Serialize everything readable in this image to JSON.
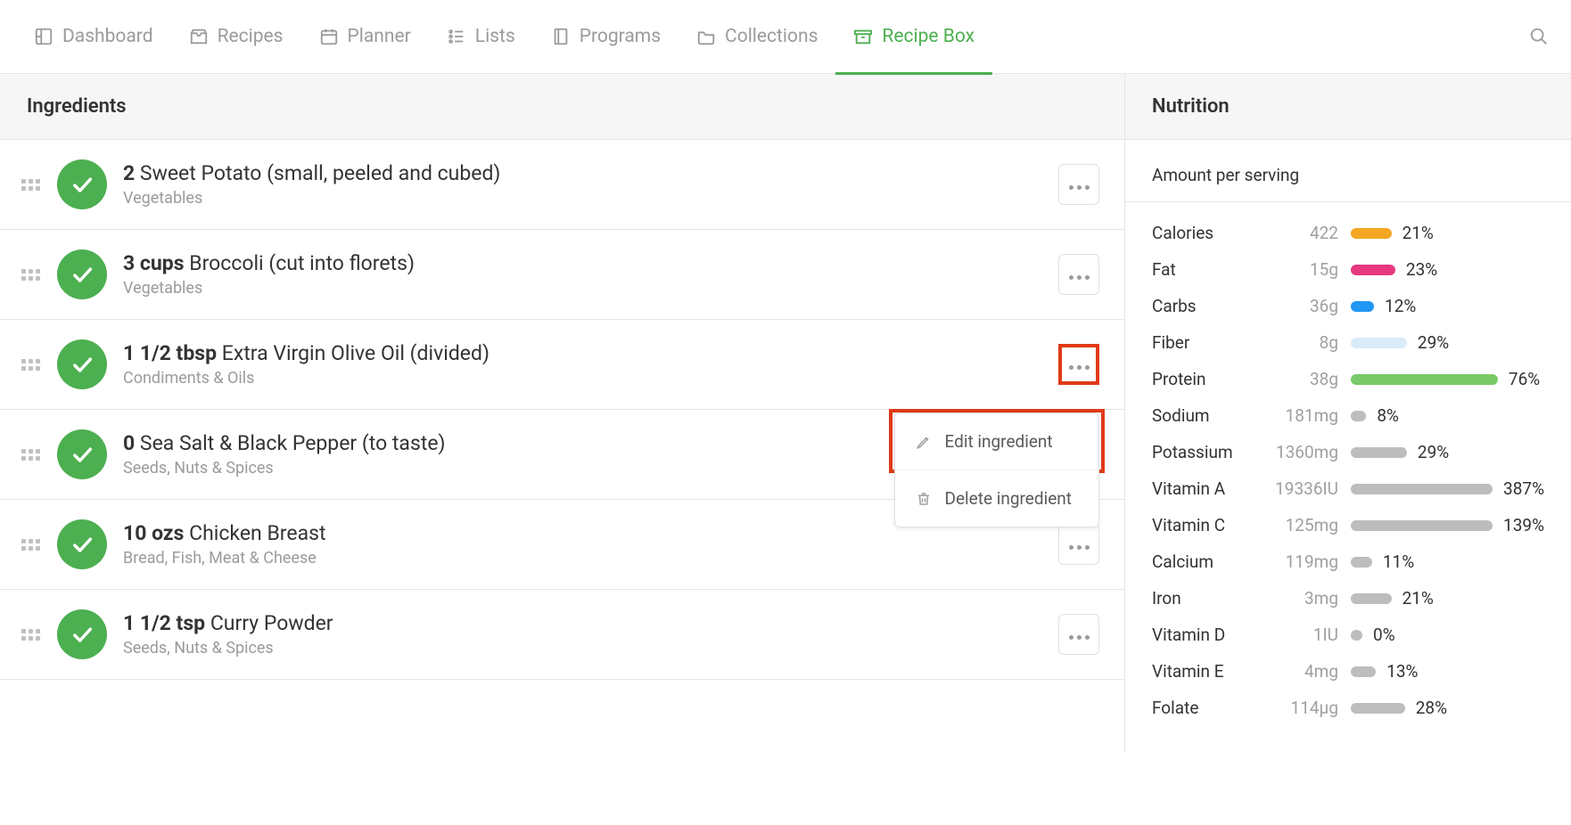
{
  "nav": {
    "items": [
      {
        "label": "Dashboard",
        "icon": "dashboard",
        "active": false
      },
      {
        "label": "Recipes",
        "icon": "inbox",
        "active": false
      },
      {
        "label": "Planner",
        "icon": "calendar",
        "active": false
      },
      {
        "label": "Lists",
        "icon": "lists",
        "active": false
      },
      {
        "label": "Programs",
        "icon": "book",
        "active": false
      },
      {
        "label": "Collections",
        "icon": "folder",
        "active": false
      },
      {
        "label": "Recipe Box",
        "icon": "box",
        "active": true
      }
    ]
  },
  "ingredients_header": "Ingredients",
  "ingredients": [
    {
      "qty": "2",
      "name": "Sweet Potato (small, peeled and cubed)",
      "category": "Vegetables"
    },
    {
      "qty": "3 cups",
      "name": "Broccoli (cut into florets)",
      "category": "Vegetables"
    },
    {
      "qty": "1 1/2 tbsp",
      "name": "Extra Virgin Olive Oil (divided)",
      "category": "Condiments & Oils"
    },
    {
      "qty": "0",
      "name": "Sea Salt & Black Pepper (to taste)",
      "category": "Seeds, Nuts & Spices"
    },
    {
      "qty": "10 ozs",
      "name": "Chicken Breast",
      "category": "Bread, Fish, Meat & Cheese"
    },
    {
      "qty": "1 1/2 tsp",
      "name": "Curry Powder",
      "category": "Seeds, Nuts & Spices"
    }
  ],
  "dropdown": {
    "edit": "Edit ingredient",
    "delete": "Delete ingredient"
  },
  "nutrition_header": "Nutrition",
  "nutrition_sub": "Amount per serving",
  "nutrition": [
    {
      "label": "Calories",
      "value": "422",
      "pct": "21%",
      "bar_pct": 21,
      "color": "#f5a623"
    },
    {
      "label": "Fat",
      "value": "15g",
      "pct": "23%",
      "bar_pct": 23,
      "color": "#e6397f"
    },
    {
      "label": "Carbs",
      "value": "36g",
      "pct": "12%",
      "bar_pct": 12,
      "color": "#2196f3"
    },
    {
      "label": "Fiber",
      "value": "8g",
      "pct": "29%",
      "bar_pct": 29,
      "color": "#d9ecf9"
    },
    {
      "label": "Protein",
      "value": "38g",
      "pct": "76%",
      "bar_pct": 76,
      "color": "#7ac968"
    },
    {
      "label": "Sodium",
      "value": "181mg",
      "pct": "8%",
      "bar_pct": 8,
      "color": "#bdbdbd"
    },
    {
      "label": "Potassium",
      "value": "1360mg",
      "pct": "29%",
      "bar_pct": 29,
      "color": "#bdbdbd"
    },
    {
      "label": "Vitamin A",
      "value": "19336IU",
      "pct": "387%",
      "bar_pct": 100,
      "color": "#bdbdbd"
    },
    {
      "label": "Vitamin C",
      "value": "125mg",
      "pct": "139%",
      "bar_pct": 100,
      "color": "#bdbdbd"
    },
    {
      "label": "Calcium",
      "value": "119mg",
      "pct": "11%",
      "bar_pct": 11,
      "color": "#bdbdbd"
    },
    {
      "label": "Iron",
      "value": "3mg",
      "pct": "21%",
      "bar_pct": 21,
      "color": "#bdbdbd"
    },
    {
      "label": "Vitamin D",
      "value": "1IU",
      "pct": "0%",
      "bar_pct": 2,
      "color": "#bdbdbd"
    },
    {
      "label": "Vitamin E",
      "value": "4mg",
      "pct": "13%",
      "bar_pct": 13,
      "color": "#bdbdbd"
    },
    {
      "label": "Folate",
      "value": "114µg",
      "pct": "28%",
      "bar_pct": 28,
      "color": "#bdbdbd"
    }
  ]
}
